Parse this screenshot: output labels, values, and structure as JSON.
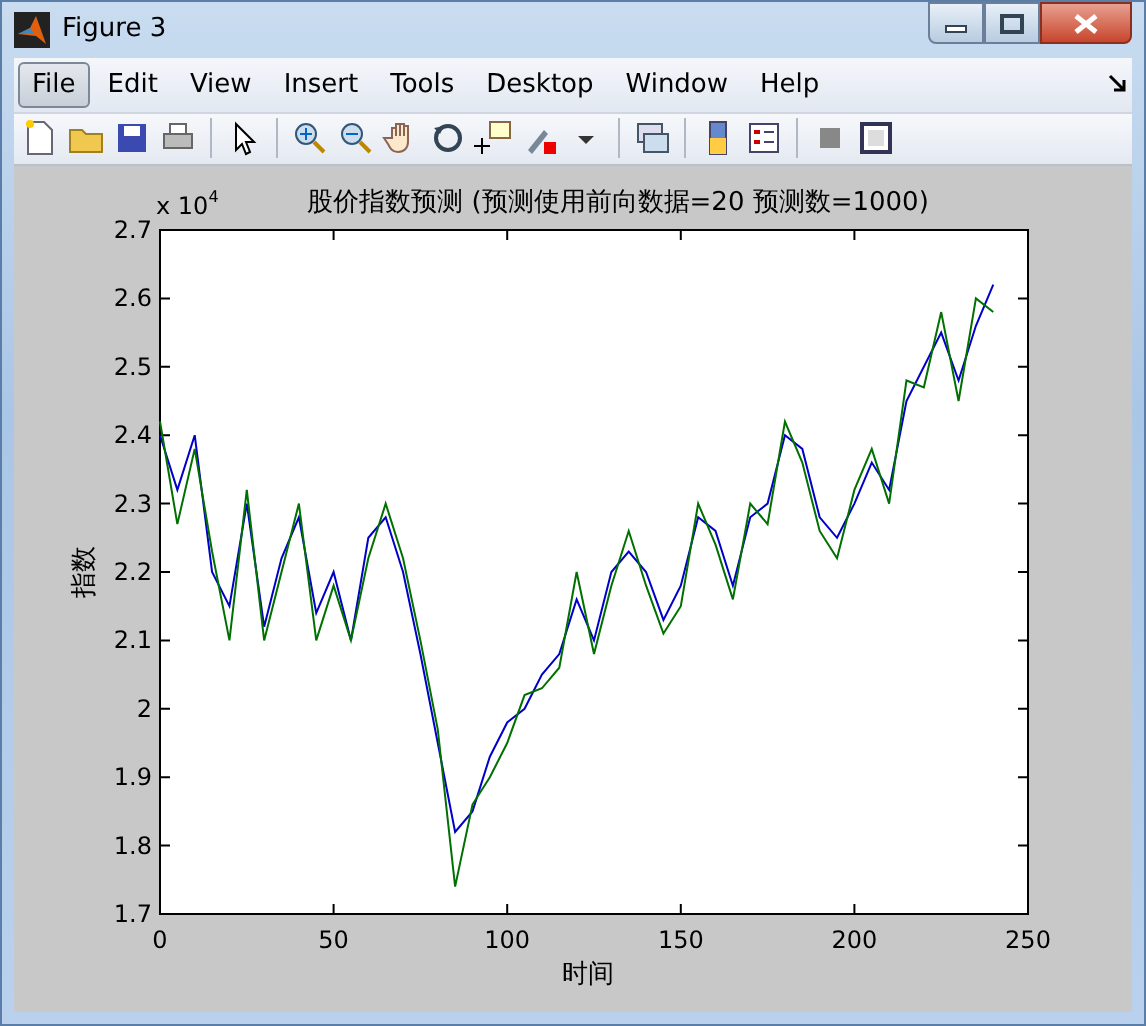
{
  "window": {
    "title": "Figure 3"
  },
  "menu": [
    {
      "label": "File",
      "selected": true
    },
    {
      "label": "Edit",
      "selected": false
    },
    {
      "label": "View",
      "selected": false
    },
    {
      "label": "Insert",
      "selected": false
    },
    {
      "label": "Tools",
      "selected": false
    },
    {
      "label": "Desktop",
      "selected": false
    },
    {
      "label": "Window",
      "selected": false
    },
    {
      "label": "Help",
      "selected": false
    }
  ],
  "axes": {
    "exponent_base": "x 10",
    "exponent": "4",
    "chart_data": {
      "type": "line",
      "title": "股价指数预测 (预测使用前向数据=20 预测数=1000)",
      "xlabel": "时间",
      "ylabel": "指数",
      "x": [
        0,
        5,
        10,
        15,
        20,
        25,
        30,
        35,
        40,
        45,
        50,
        55,
        60,
        65,
        70,
        75,
        80,
        85,
        90,
        95,
        100,
        105,
        110,
        115,
        120,
        125,
        130,
        135,
        140,
        145,
        150,
        155,
        160,
        165,
        170,
        175,
        180,
        185,
        190,
        195,
        200,
        205,
        210,
        215,
        220,
        225,
        230,
        235,
        240
      ],
      "xlim": [
        0,
        250
      ],
      "ylim": [
        1.7,
        2.7
      ],
      "xticks": [
        0,
        50,
        100,
        150,
        200,
        250
      ],
      "yticks": [
        1.7,
        1.8,
        1.9,
        2,
        2.1,
        2.2,
        2.3,
        2.4,
        2.5,
        2.6,
        2.7
      ],
      "series": [
        {
          "color": "#0000c8",
          "values": [
            2.4,
            2.32,
            2.4,
            2.2,
            2.15,
            2.3,
            2.12,
            2.22,
            2.28,
            2.14,
            2.2,
            2.1,
            2.25,
            2.28,
            2.2,
            2.08,
            1.95,
            1.82,
            1.85,
            1.93,
            1.98,
            2.0,
            2.05,
            2.08,
            2.16,
            2.1,
            2.2,
            2.23,
            2.2,
            2.13,
            2.18,
            2.28,
            2.26,
            2.18,
            2.28,
            2.3,
            2.4,
            2.38,
            2.28,
            2.25,
            2.3,
            2.36,
            2.32,
            2.45,
            2.5,
            2.55,
            2.48,
            2.56,
            2.62
          ]
        },
        {
          "color": "#007000",
          "values": [
            2.42,
            2.27,
            2.38,
            2.23,
            2.1,
            2.32,
            2.1,
            2.2,
            2.3,
            2.1,
            2.18,
            2.1,
            2.22,
            2.3,
            2.22,
            2.1,
            1.97,
            1.74,
            1.86,
            1.9,
            1.95,
            2.02,
            2.03,
            2.06,
            2.2,
            2.08,
            2.18,
            2.26,
            2.18,
            2.11,
            2.15,
            2.3,
            2.24,
            2.16,
            2.3,
            2.27,
            2.42,
            2.36,
            2.26,
            2.22,
            2.32,
            2.38,
            2.3,
            2.48,
            2.47,
            2.58,
            2.45,
            2.6,
            2.58
          ]
        }
      ]
    }
  }
}
